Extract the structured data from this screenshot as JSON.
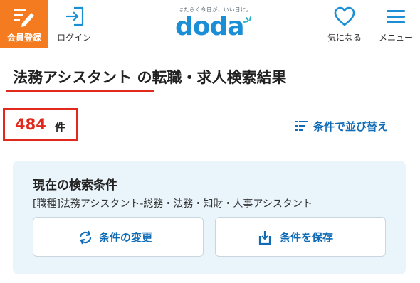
{
  "header": {
    "signup_label": "会員登録",
    "login_label": "ログイン",
    "logo_tagline": "はたらく今日が、いい日に。",
    "logo_word": "doda",
    "favorites_label": "気になる",
    "menu_label": "メニュー"
  },
  "search": {
    "title": "法務アシスタント の転職・求人検索結果",
    "count": "484",
    "count_unit": "件",
    "sort_label": "条件で並び替え"
  },
  "conditions": {
    "heading": "現在の検索条件",
    "summary": "[職種]法務アシスタント-総務・法務・知財・人事アシスタント",
    "change_label": "条件の変更",
    "save_label": "条件を保存"
  },
  "colors": {
    "accent_orange": "#f47b20",
    "brand_blue": "#1a8fd6",
    "link_blue": "#0f6bb5",
    "highlight_red": "#e0291c",
    "panel_bg": "#eaf4fb"
  },
  "icons": {
    "signup": "pencil-list-icon",
    "login": "login-arrow-icon",
    "favorites": "heart-icon",
    "menu": "hamburger-icon",
    "sort": "sort-list-icon",
    "change": "refresh-icon",
    "save": "download-icon"
  }
}
